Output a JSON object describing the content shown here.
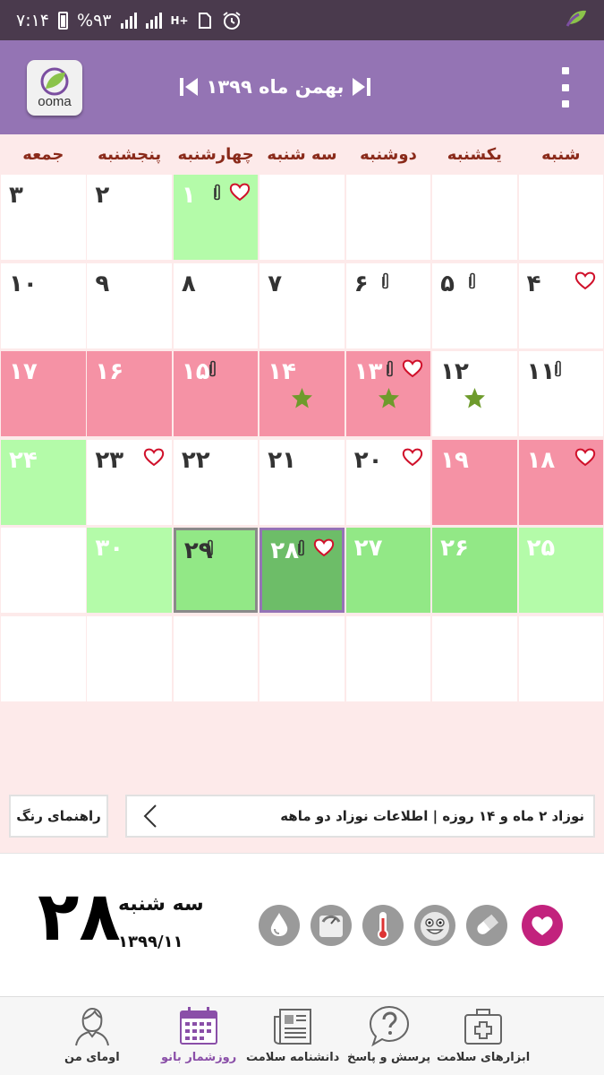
{
  "status_bar": {
    "time": "۷:۱۴",
    "battery": "%۹۳",
    "network": "H+"
  },
  "app_bar": {
    "logo_text": "ooma",
    "month_title": "بهمن ماه ۱۳۹۹"
  },
  "weekdays": [
    "شنبه",
    "یکشنبه",
    "دوشنبه",
    "سه شنبه",
    "چهارشنبه",
    "پنجشنبه",
    "جمعه"
  ],
  "calendar": {
    "weeks": [
      [
        {
          "day": "",
          "color": "white"
        },
        {
          "day": "",
          "color": "white"
        },
        {
          "day": "",
          "color": "white"
        },
        {
          "day": "",
          "color": "white"
        },
        {
          "day": "۱",
          "color": "lgreen",
          "heart": true,
          "clip": true
        },
        {
          "day": "۲",
          "color": "white"
        },
        {
          "day": "۳",
          "color": "white"
        }
      ],
      [
        {
          "day": "۴",
          "color": "white",
          "heart": true
        },
        {
          "day": "۵",
          "color": "white",
          "clip": true
        },
        {
          "day": "۶",
          "color": "white",
          "clip": true
        },
        {
          "day": "۷",
          "color": "white"
        },
        {
          "day": "۸",
          "color": "white"
        },
        {
          "day": "۹",
          "color": "white"
        },
        {
          "day": "۱۰",
          "color": "white"
        }
      ],
      [
        {
          "day": "۱۱",
          "color": "white",
          "clip": true
        },
        {
          "day": "۱۲",
          "color": "white",
          "star": true
        },
        {
          "day": "۱۳",
          "color": "pink",
          "heart": true,
          "clip": true,
          "star": true
        },
        {
          "day": "۱۴",
          "color": "pink",
          "star": true
        },
        {
          "day": "۱۵",
          "color": "pink",
          "clip": true
        },
        {
          "day": "۱۶",
          "color": "pink"
        },
        {
          "day": "۱۷",
          "color": "pink"
        }
      ],
      [
        {
          "day": "۱۸",
          "color": "pink",
          "heart": true
        },
        {
          "day": "۱۹",
          "color": "pink"
        },
        {
          "day": "۲۰",
          "color": "white",
          "heart": true
        },
        {
          "day": "۲۱",
          "color": "white"
        },
        {
          "day": "۲۲",
          "color": "white"
        },
        {
          "day": "۲۳",
          "color": "white",
          "heart": true
        },
        {
          "day": "۲۴",
          "color": "lgreen"
        }
      ],
      [
        {
          "day": "۲۵",
          "color": "lgreen"
        },
        {
          "day": "۲۶",
          "color": "green"
        },
        {
          "day": "۲۷",
          "color": "green"
        },
        {
          "day": "۲۸",
          "color": "dgreen",
          "heart": true,
          "clip": true,
          "selected": true
        },
        {
          "day": "۲۹",
          "color": "selgreen",
          "clip": true
        },
        {
          "day": "۳۰",
          "color": "lgreen"
        },
        {
          "day": "",
          "color": "white"
        }
      ],
      [
        {
          "day": "",
          "color": "white"
        },
        {
          "day": "",
          "color": "white"
        },
        {
          "day": "",
          "color": "white"
        },
        {
          "day": "",
          "color": "white"
        },
        {
          "day": "",
          "color": "white"
        },
        {
          "day": "",
          "color": "white"
        },
        {
          "day": "",
          "color": "white"
        }
      ]
    ]
  },
  "info_row": {
    "guide_button": "راهنمای رنگ",
    "info_text": "نوزاد ۲ ماه و ۱۴ روزه | اطلاعات نوزاد دو ماهه"
  },
  "day_panel": {
    "day_number": "۲۸",
    "weekday": "سه شنبه",
    "date": "۱۳۹۹/۱۱",
    "icons": [
      "heart-icon",
      "pill-icon",
      "smiley-icon",
      "thermometer-icon",
      "scale-icon",
      "drop-icon"
    ]
  },
  "bottom_nav": {
    "items": [
      {
        "label": "اومای من",
        "icon": "woman-icon"
      },
      {
        "label": "روزشمار بانو",
        "icon": "calendar-icon",
        "active": true
      },
      {
        "label": "دانشنامه سلامت",
        "icon": "newspaper-icon"
      },
      {
        "label": "پرسش و پاسخ",
        "icon": "question-icon"
      },
      {
        "label": "ابزارهای سلامت",
        "icon": "medical-kit-icon"
      }
    ]
  },
  "colors": {
    "app_bar": "#9474b4",
    "status_bar": "#4a3a4d",
    "pink": "#f592a5",
    "light_green": "#b4fba9",
    "green": "#92e886",
    "selected_green": "#6dbd68",
    "heart_active": "#c2227d",
    "weekday_text": "#8a2a1a"
  }
}
